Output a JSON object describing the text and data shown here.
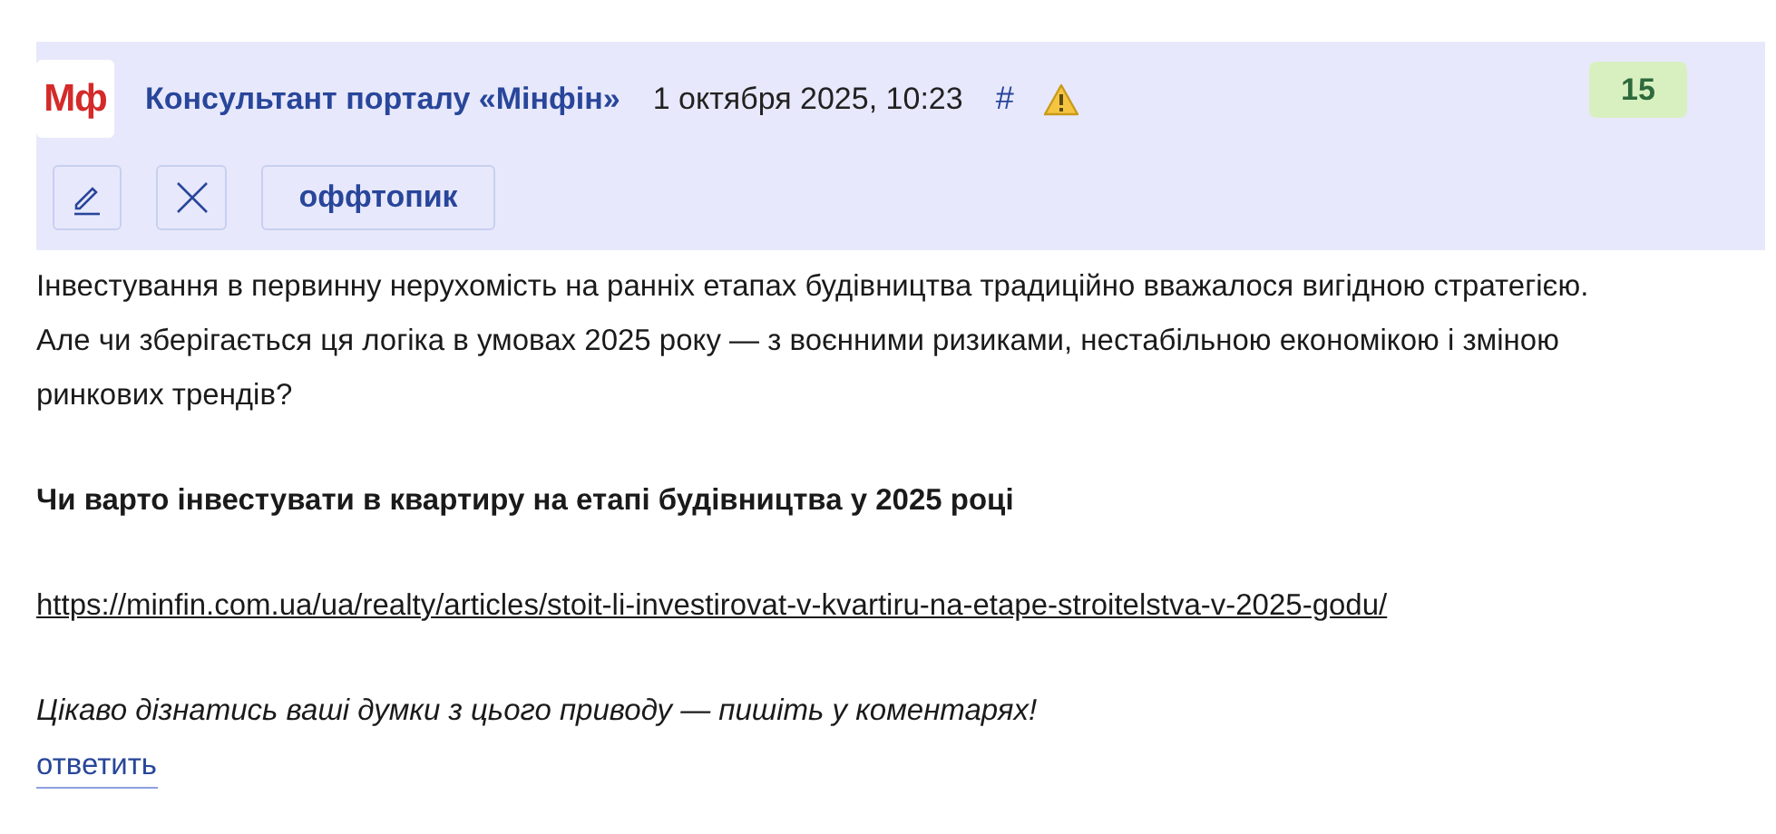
{
  "post": {
    "author": "Консультант порталу «Мінфін»",
    "logo": "Мф",
    "date": "1 октября 2025, 10:23",
    "anchor": "#",
    "rating": "15",
    "actions": [
      {
        "kind": "edit"
      },
      {
        "kind": "delete"
      },
      {
        "kind": "label",
        "label": "оффтопик"
      }
    ],
    "paragraphs": [
      {
        "kind": "text",
        "text": "Інвестування в первинну нерухомість на ранніх етапах будівництва традиційно вважалося вигідною стратегією. Але чи зберігається ця логіка в умовах 2025 року — з воєнними ризиками, нестабільною економікою і зміною ринкових трендів?"
      },
      {
        "kind": "bold",
        "text": "Чи варто інвестувати в квартиру на етапі будівництва у 2025 році"
      },
      {
        "kind": "link",
        "text": "https://minfin.com.ua/ua/realty/articles/stoit-li-investirovat-v-kvartiru-na-etape-stroitelstva-v-2025-godu/"
      },
      {
        "kind": "italic",
        "text": "Цікаво дізнатись ваші думки з цього приводу — пишіть у коментарях!"
      }
    ],
    "reply": "ответить"
  }
}
